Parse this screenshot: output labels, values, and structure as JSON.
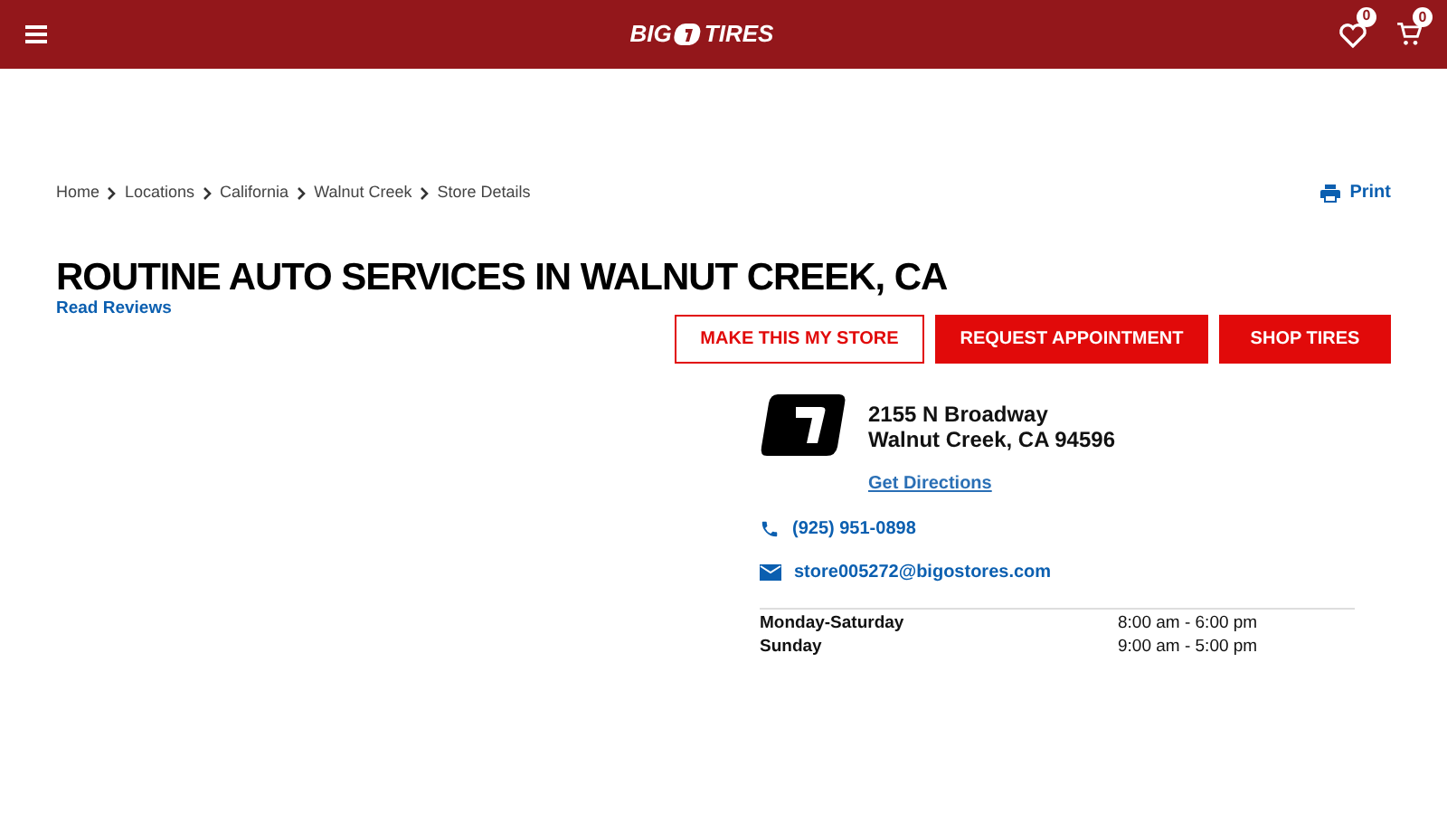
{
  "header": {
    "logo_left": "BIG",
    "logo_right": "TIRES",
    "wishlist_count": "0",
    "cart_count": "0"
  },
  "breadcrumbs": [
    "Home",
    "Locations",
    "California",
    "Walnut Creek",
    "Store Details"
  ],
  "print_label": "Print",
  "title": "ROUTINE AUTO SERVICES IN WALNUT CREEK, CA",
  "reviews_link": "Read Reviews",
  "buttons": [
    {
      "label": "MAKE THIS MY STORE",
      "kind": "outline"
    },
    {
      "label": "REQUEST APPOINTMENT",
      "kind": "filled"
    },
    {
      "label": "SHOP TIRES",
      "kind": "filled"
    }
  ],
  "store": {
    "address_line_1": "2155 N Broadway",
    "address_line_2": "Walnut Creek, CA 94596",
    "directions": "Get Directions",
    "phone": "(925) 951-0898",
    "email": "store005272@bigostores.com"
  },
  "hours": [
    {
      "days": "Monday-Saturday",
      "time": "8:00 am - 6:00 pm"
    },
    {
      "days": "Sunday",
      "time": "9:00 am - 5:00 pm"
    }
  ]
}
